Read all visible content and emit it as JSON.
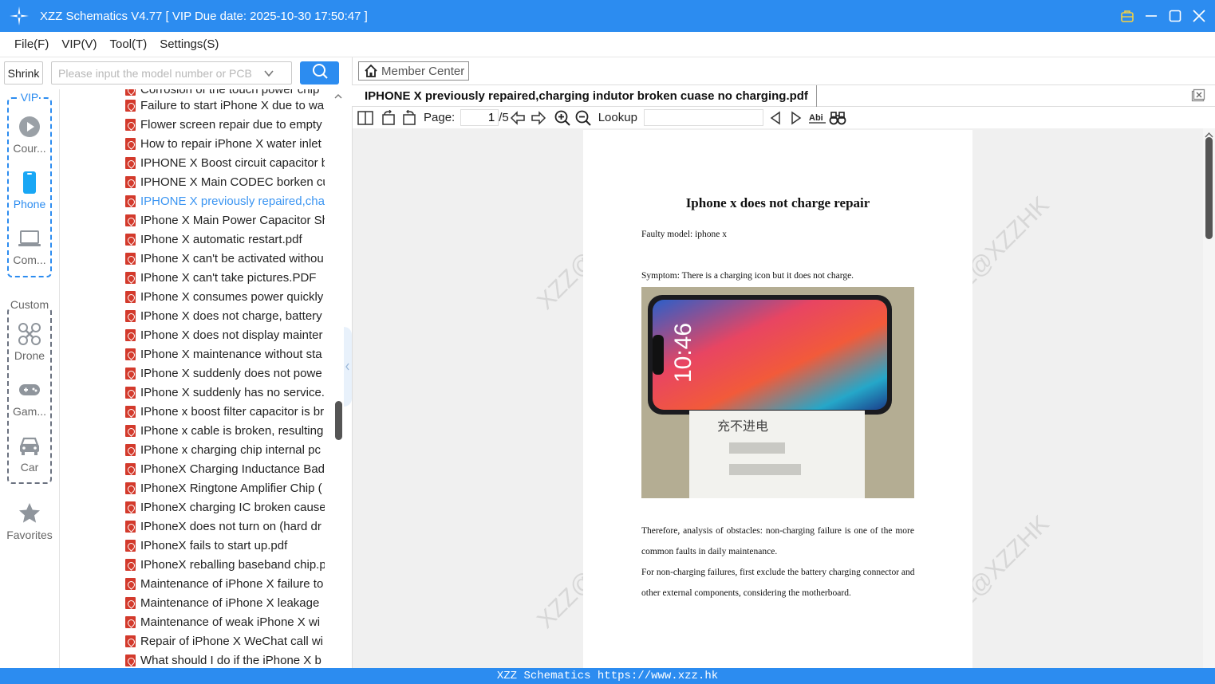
{
  "window": {
    "title": "XZZ Schematics V4.77 [ VIP Due date: 2025-10-30 17:50:47 ]"
  },
  "menu": [
    "File(F)",
    "VIP(V)",
    "Tool(T)",
    "Settings(S)"
  ],
  "toolbar": {
    "shrink_label": "Shrink",
    "search_placeholder": "Please input the model number or PCB"
  },
  "rail": {
    "vip_label": "VIP",
    "custom_label": "Custom",
    "items": [
      {
        "label": "Cour...",
        "icon": "play-icon"
      },
      {
        "label": "Phone",
        "icon": "phone-icon"
      },
      {
        "label": "Com...",
        "icon": "laptop-icon"
      },
      {
        "label": "Drone",
        "icon": "drone-icon"
      },
      {
        "label": "Gam...",
        "icon": "gamepad-icon"
      },
      {
        "label": "Car",
        "icon": "car-icon"
      },
      {
        "label": "Favorites",
        "icon": "star-icon"
      }
    ]
  },
  "file_list": {
    "partial_top": "Corrosion of the touch power chip",
    "items": [
      "Failure to start iPhone X due to wa",
      "Flower screen repair due to empty",
      "How to repair iPhone X water inlet",
      "IPHONE X Boost circuit capacitor b",
      "IPHONE X Main CODEC borken cu",
      "IPHONE X previously repaired,char",
      "IPhone X Main Power Capacitor Sh",
      "IPhone X automatic restart.pdf",
      "IPhone X can't be activated withou",
      "IPhone X can't take pictures.PDF",
      "IPhone X consumes power quickly",
      "IPhone X does not charge, battery",
      "IPhone X does not display mainter",
      "IPhone X maintenance without sta",
      "IPhone X suddenly does not powe",
      "IPhone X suddenly has no service.p",
      "IPhone x boost filter capacitor is br",
      "IPhone x cable is broken, resulting",
      "IPhone x charging chip internal pc",
      "IPhoneX Charging Inductance Bad",
      "IPhoneX Ringtone Amplifier Chip (",
      "IPhoneX charging IC broken cause",
      "IPhoneX does not turn on (hard dr",
      "IPhoneX fails to start up.pdf",
      "IPhoneX reballing baseband chip.p",
      "Maintenance of iPhone X failure to",
      "Maintenance of iPhone X leakage",
      "Maintenance of weak iPhone X wi",
      "Repair of iPhone X WeChat call wi",
      "What should I do if the iPhone X b"
    ],
    "selected_index": 5
  },
  "viewer": {
    "member_center": "Member Center",
    "tab_title": "IPHONE X previously repaired,charging indutor broken cuase no charging.pdf",
    "page_label": "Page:",
    "page_current": "1",
    "page_total": "/5",
    "lookup_label": "Lookup"
  },
  "document": {
    "heading": "Iphone x does not charge repair",
    "faulty_model": "Faulty model: iphone x",
    "symptom": "Symptom: There is a charging icon but it does not charge.",
    "para1": "Therefore, analysis of obstacles: non-charging failure is one of the more common faults in daily maintenance.",
    "para2": "For non-charging failures, first exclude the battery charging connector and other external components, considering the motherboard.",
    "watermark": "XZZ@XZZHK",
    "photo_time": "10:46",
    "note_text": "充不进电"
  },
  "status": {
    "text": "XZZ Schematics https://www.xzz.hk"
  },
  "colors": {
    "accent": "#2c8cf0",
    "selected_text": "#3b95f2",
    "pdf_icon": "#d33a2c"
  }
}
